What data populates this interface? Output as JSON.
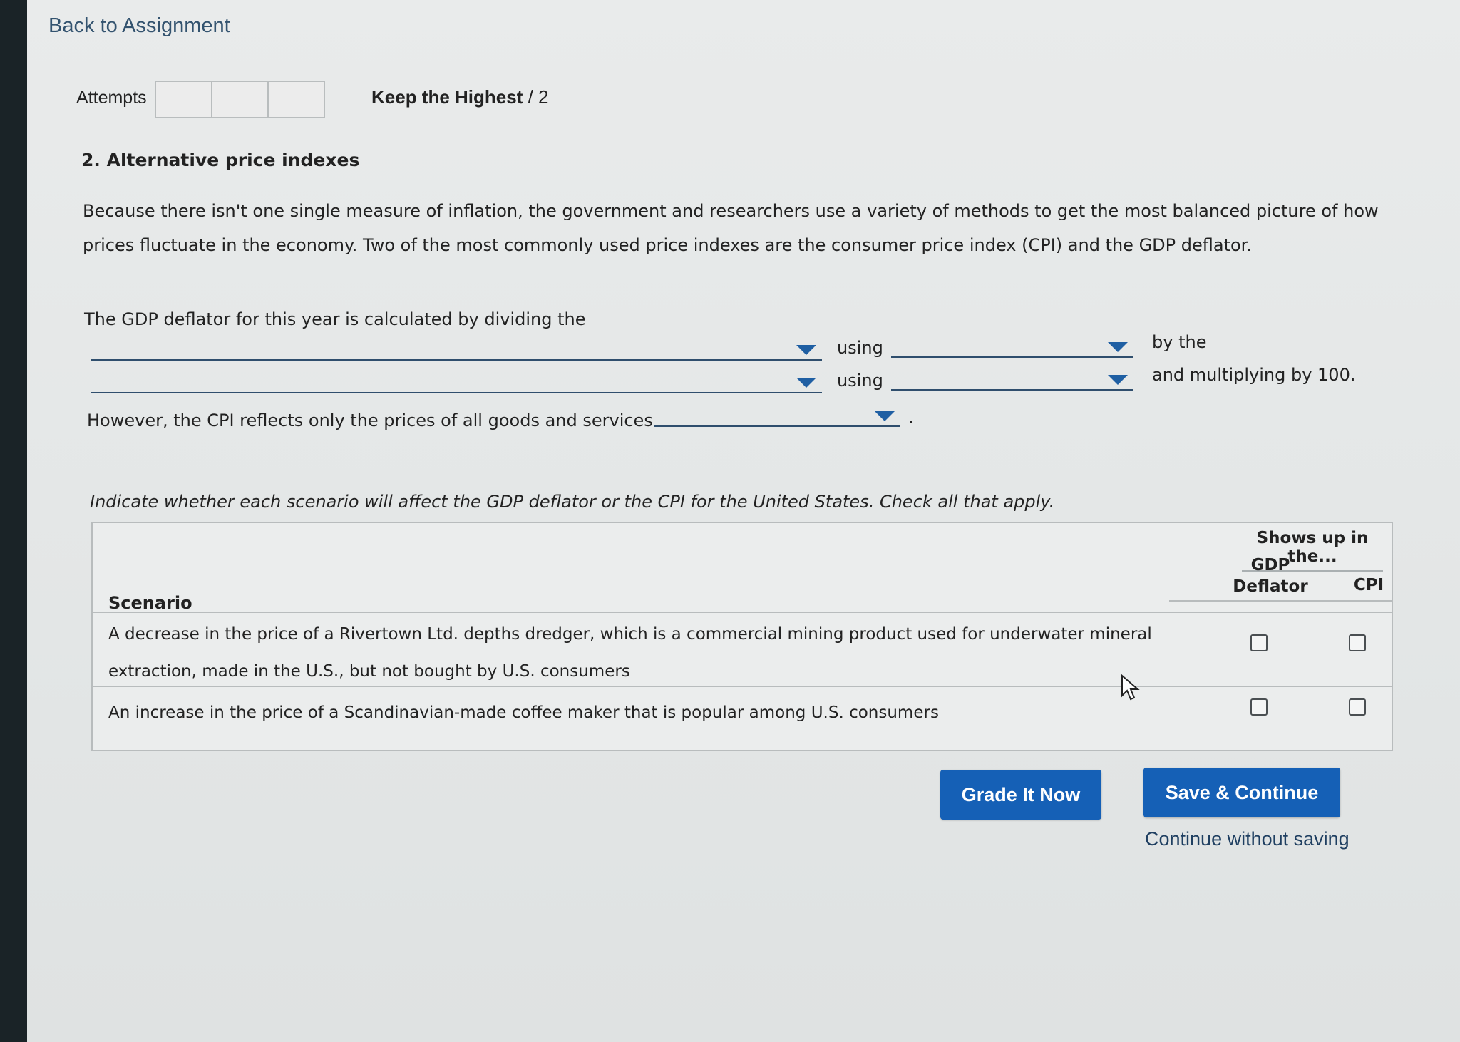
{
  "nav": {
    "back_label": "Back to Assignment"
  },
  "attempts": {
    "label": "Attempts",
    "box_count": 3
  },
  "grading": {
    "policy": "Keep the Highest",
    "points": "/ 2"
  },
  "question": {
    "title": "2. Alternative price indexes",
    "intro": "Because there isn't one single measure of inflation, the government and researchers use a variety of methods to get the most balanced picture of how prices fluctuate in the economy. Two of the most commonly used price indexes are the consumer price index (CPI) and the GDP deflator.",
    "gdp_sentence_start": "The GDP deflator for this year is calculated by dividing the",
    "using_1": "using",
    "by_the": "by the",
    "using_2": "using",
    "multiply_text": "and multiplying by 100.",
    "cpi_sentence": "However, the CPI reflects only the prices of all goods and services",
    "cpi_period": ".",
    "instruction": "Indicate whether each scenario will affect the GDP deflator or the CPI for the United States. Check all that apply."
  },
  "table": {
    "group_header": "Shows up in the...",
    "col_gdp_line1": "GDP",
    "col_gdp_line2": "Deflator",
    "col_cpi": "CPI",
    "scenario_header": "Scenario",
    "rows": [
      {
        "text": "A decrease in the price of a Rivertown Ltd. depths dredger, which is a commercial mining product used for underwater mineral extraction, made in the U.S., but not bought by U.S. consumers",
        "gdp_checked": false,
        "cpi_checked": false
      },
      {
        "text": "An increase in the price of a Scandinavian-made coffee maker that is popular among U.S. consumers",
        "gdp_checked": false,
        "cpi_checked": false
      }
    ]
  },
  "buttons": {
    "grade": "Grade It Now",
    "save": "Save & Continue",
    "continue_link": "Continue without saving"
  },
  "colors": {
    "primary_button": "#1560b6",
    "link": "#33536f",
    "dropdown_arrow": "#1f5fa3",
    "sidebar": "#1a2327"
  }
}
